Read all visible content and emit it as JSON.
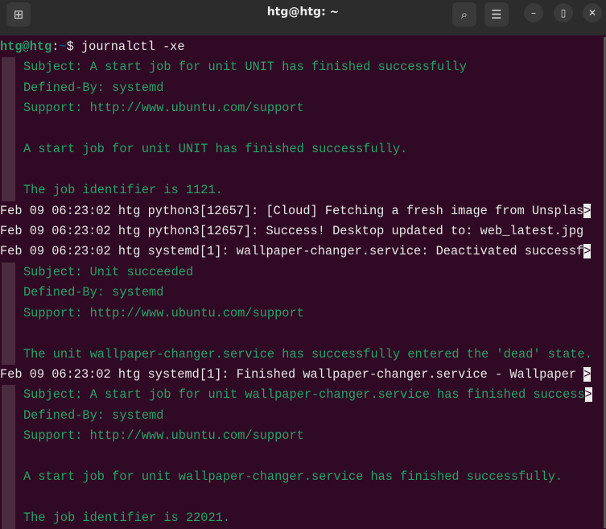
{
  "window": {
    "title": "htg@htg: ~",
    "new_tab_icon": "new-tab-icon",
    "search_icon": "search-icon",
    "menu_icon": "hamburger-icon"
  },
  "prompt": {
    "user": "htg@htg",
    "sep": ":",
    "path": "~",
    "dollar": "$ ",
    "command": "journalctl -xe"
  },
  "lines": [
    {
      "type": "detail",
      "text": "Subject: A start job for unit UNIT has finished successfully"
    },
    {
      "type": "detail",
      "text": "Defined-By: systemd"
    },
    {
      "type": "detail",
      "text": "Support: http://www.ubuntu.com/support"
    },
    {
      "type": "detail",
      "text": ""
    },
    {
      "type": "detail",
      "text": "A start job for unit UNIT has finished successfully."
    },
    {
      "type": "detail",
      "text": ""
    },
    {
      "type": "detail",
      "text": "The job identifier is 1121."
    },
    {
      "type": "log",
      "text": "Feb 09 06:23:02 htg python3[12657]: [Cloud] Fetching a fresh image from Unsplas",
      "truncated": ">"
    },
    {
      "type": "log",
      "text": "Feb 09 06:23:02 htg python3[12657]: Success! Desktop updated to: web_latest.jpg"
    },
    {
      "type": "log",
      "text": "Feb 09 06:23:02 htg systemd[1]: wallpaper-changer.service: Deactivated successf",
      "truncated": ">"
    },
    {
      "type": "detail",
      "text": "Subject: Unit succeeded"
    },
    {
      "type": "detail",
      "text": "Defined-By: systemd"
    },
    {
      "type": "detail",
      "text": "Support: http://www.ubuntu.com/support"
    },
    {
      "type": "detail",
      "text": ""
    },
    {
      "type": "detail",
      "text": "The unit wallpaper-changer.service has successfully entered the 'dead' state."
    },
    {
      "type": "log",
      "text": "Feb 09 06:23:02 htg systemd[1]: Finished wallpaper-changer.service - Wallpaper ",
      "truncated": ">"
    },
    {
      "type": "detail",
      "text": "Subject: A start job for unit wallpaper-changer.service has finished success",
      "truncated": ">"
    },
    {
      "type": "detail",
      "text": "Defined-By: systemd"
    },
    {
      "type": "detail",
      "text": "Support: http://www.ubuntu.com/support"
    },
    {
      "type": "detail",
      "text": ""
    },
    {
      "type": "detail",
      "text": "A start job for unit wallpaper-changer.service has finished successfully."
    },
    {
      "type": "detail",
      "text": ""
    },
    {
      "type": "detail",
      "text": "The job identifier is 22021."
    }
  ]
}
